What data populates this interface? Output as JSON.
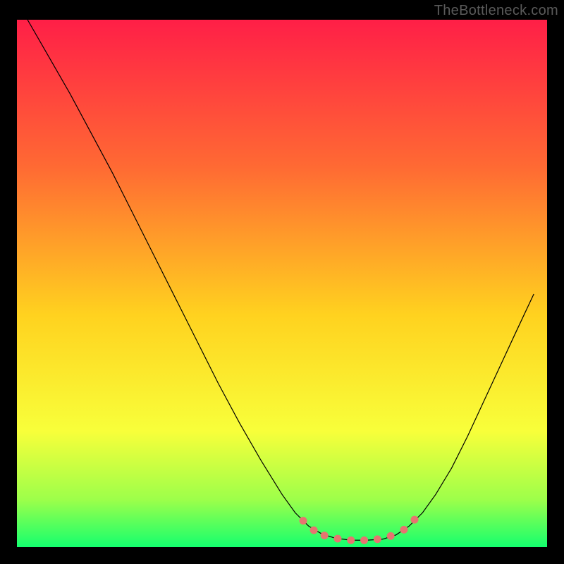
{
  "watermark": "TheBottleneck.com",
  "chart_data": {
    "type": "line",
    "title": "",
    "xlabel": "",
    "ylabel": "",
    "xlim": [
      0,
      100
    ],
    "ylim": [
      0,
      100
    ],
    "grid": false,
    "legend": false,
    "background_gradient": {
      "top": "#ff1f47",
      "mid_upper": "#ff6a33",
      "mid": "#ffd21f",
      "mid_lower": "#f8ff3a",
      "lower": "#9dff4a",
      "bottom": "#14ff6e"
    },
    "series": [
      {
        "name": "curve",
        "color": "#000000",
        "stroke_width": 1.2,
        "points": [
          {
            "x": 2.0,
            "y": 100.0
          },
          {
            "x": 6.0,
            "y": 93.0
          },
          {
            "x": 10.0,
            "y": 86.0
          },
          {
            "x": 14.0,
            "y": 78.5
          },
          {
            "x": 18.0,
            "y": 71.0
          },
          {
            "x": 22.0,
            "y": 63.0
          },
          {
            "x": 26.0,
            "y": 55.0
          },
          {
            "x": 30.0,
            "y": 47.0
          },
          {
            "x": 34.0,
            "y": 39.0
          },
          {
            "x": 38.0,
            "y": 31.0
          },
          {
            "x": 42.0,
            "y": 23.5
          },
          {
            "x": 46.0,
            "y": 16.5
          },
          {
            "x": 50.0,
            "y": 10.0
          },
          {
            "x": 52.5,
            "y": 6.5
          },
          {
            "x": 55.0,
            "y": 4.0
          },
          {
            "x": 57.5,
            "y": 2.5
          },
          {
            "x": 60.0,
            "y": 1.7
          },
          {
            "x": 63.0,
            "y": 1.3
          },
          {
            "x": 66.0,
            "y": 1.3
          },
          {
            "x": 69.0,
            "y": 1.5
          },
          {
            "x": 71.5,
            "y": 2.3
          },
          {
            "x": 74.0,
            "y": 4.0
          },
          {
            "x": 76.5,
            "y": 6.5
          },
          {
            "x": 79.0,
            "y": 10.0
          },
          {
            "x": 82.0,
            "y": 15.0
          },
          {
            "x": 85.0,
            "y": 21.0
          },
          {
            "x": 88.0,
            "y": 27.5
          },
          {
            "x": 91.0,
            "y": 34.0
          },
          {
            "x": 94.0,
            "y": 40.5
          },
          {
            "x": 97.5,
            "y": 48.0
          }
        ]
      },
      {
        "name": "highlight-dots",
        "color": "#e77470",
        "marker": "circle",
        "marker_radius": 5.5,
        "points": [
          {
            "x": 54.0,
            "y": 5.0
          },
          {
            "x": 56.0,
            "y": 3.2
          },
          {
            "x": 58.0,
            "y": 2.2
          },
          {
            "x": 60.5,
            "y": 1.6
          },
          {
            "x": 63.0,
            "y": 1.3
          },
          {
            "x": 65.5,
            "y": 1.3
          },
          {
            "x": 68.0,
            "y": 1.5
          },
          {
            "x": 70.5,
            "y": 2.1
          },
          {
            "x": 73.0,
            "y": 3.3
          },
          {
            "x": 75.0,
            "y": 5.2
          }
        ]
      }
    ]
  }
}
